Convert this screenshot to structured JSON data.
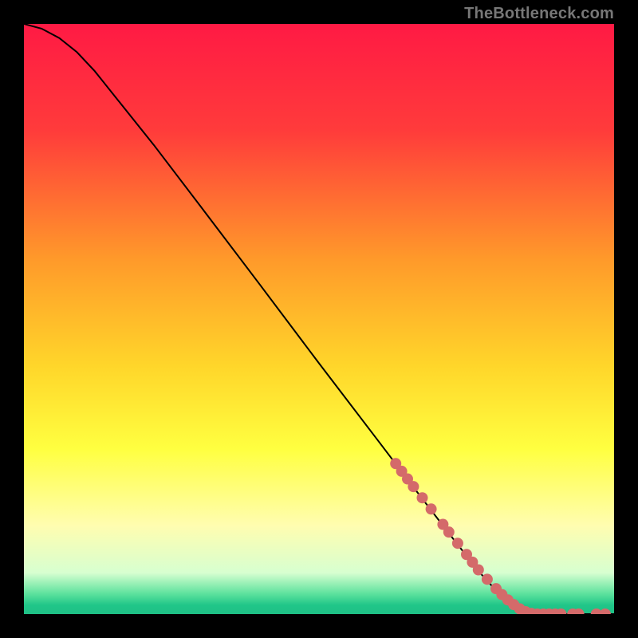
{
  "watermark": "TheBottleneck.com",
  "chart_data": {
    "type": "line",
    "title": "",
    "xlabel": "",
    "ylabel": "",
    "xlim": [
      0,
      100
    ],
    "ylim": [
      0,
      100
    ],
    "grid": false,
    "legend": false,
    "background_gradient": {
      "stops": [
        {
          "offset": 0.0,
          "color": "#ff1a44"
        },
        {
          "offset": 0.18,
          "color": "#ff3b3b"
        },
        {
          "offset": 0.4,
          "color": "#ff9a2a"
        },
        {
          "offset": 0.58,
          "color": "#ffd62a"
        },
        {
          "offset": 0.72,
          "color": "#ffff40"
        },
        {
          "offset": 0.85,
          "color": "#fffdb0"
        },
        {
          "offset": 0.93,
          "color": "#d7ffd0"
        },
        {
          "offset": 0.965,
          "color": "#5fe29e"
        },
        {
          "offset": 0.985,
          "color": "#20c688"
        },
        {
          "offset": 1.0,
          "color": "#1fc086"
        }
      ]
    },
    "series": [
      {
        "name": "curve",
        "stroke": "#000000",
        "x": [
          0.0,
          3.0,
          6.0,
          9.0,
          12.0,
          16.0,
          22.0,
          30.0,
          40.0,
          50.0,
          60.0,
          66.0,
          72.0,
          77.0,
          80.0,
          83.0,
          85.0,
          88.0,
          100.0
        ],
        "y": [
          100.0,
          99.2,
          97.6,
          95.2,
          92.0,
          87.0,
          79.5,
          69.0,
          55.8,
          42.5,
          29.4,
          21.5,
          13.7,
          7.3,
          4.0,
          1.6,
          0.5,
          0.0,
          0.0
        ]
      }
    ],
    "markers": {
      "name": "dots",
      "color": "#d46a6a",
      "radius_px": 7,
      "x": [
        63.0,
        64.0,
        65.0,
        66.0,
        67.5,
        69.0,
        71.0,
        72.0,
        73.5,
        75.0,
        76.0,
        77.0,
        78.5,
        80.0,
        81.0,
        82.0,
        83.0,
        84.0,
        85.0,
        86.0,
        87.0,
        88.0,
        89.0,
        90.0,
        91.0,
        93.0,
        94.0,
        97.0,
        98.5
      ],
      "y": [
        25.5,
        24.2,
        22.9,
        21.6,
        19.7,
        17.8,
        15.2,
        13.9,
        12.0,
        10.1,
        8.8,
        7.5,
        5.9,
        4.3,
        3.3,
        2.4,
        1.6,
        0.9,
        0.4,
        0.1,
        0.0,
        0.0,
        0.0,
        0.0,
        0.0,
        0.0,
        0.0,
        0.0,
        0.0
      ]
    }
  }
}
